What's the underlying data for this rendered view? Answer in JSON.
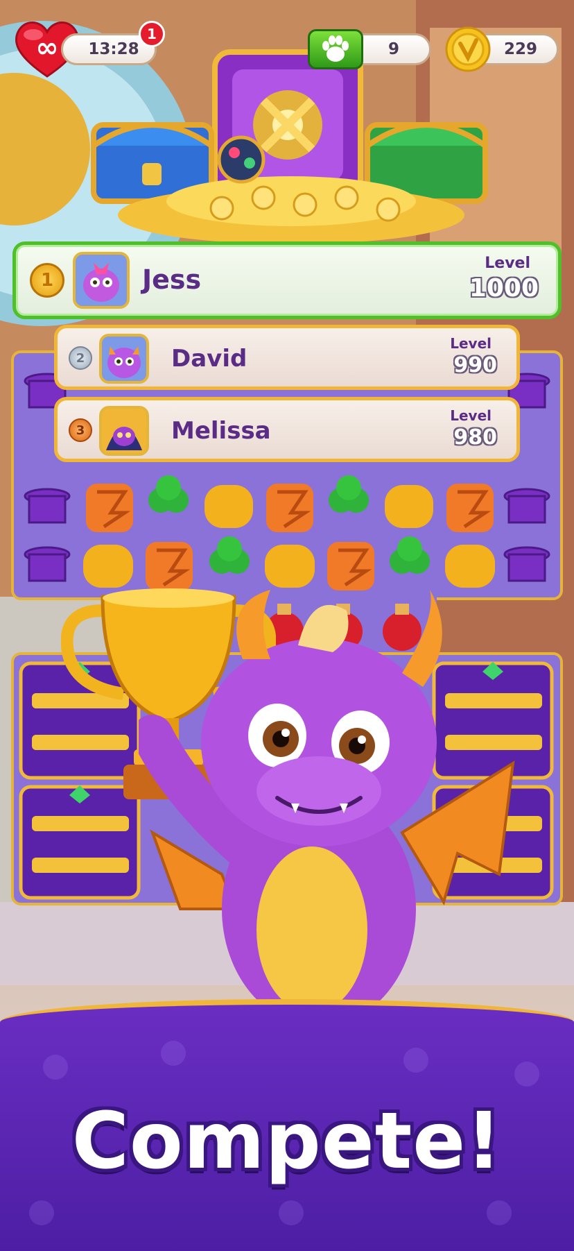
{
  "hud": {
    "lives_symbol": "∞",
    "lives_timer": "13:28",
    "notification_count": "1",
    "paws": "9",
    "coins": "229"
  },
  "leaderboard": [
    {
      "rank": "1",
      "name": "Jess",
      "level_label": "Level",
      "level": "1000"
    },
    {
      "rank": "2",
      "name": "David",
      "level_label": "Level",
      "level": "990"
    },
    {
      "rank": "3",
      "name": "Melissa",
      "level_label": "Level",
      "level": "980"
    }
  ],
  "banner": {
    "title": "Compete!"
  },
  "colors": {
    "first_place_border": "#4fbf2a",
    "other_place_border": "#f2b636",
    "banner_purple": "#5a22b0",
    "name_color": "#5a2c86"
  }
}
